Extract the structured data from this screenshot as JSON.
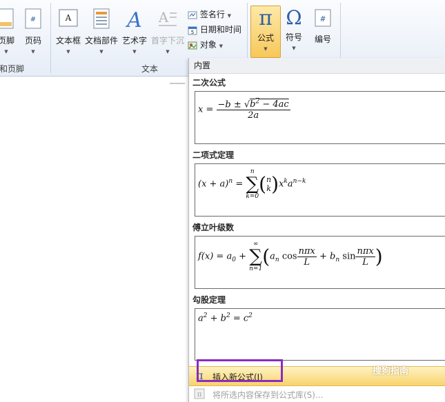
{
  "ribbon": {
    "groups": [
      {
        "label": "和页脚"
      },
      {
        "label": "文本"
      }
    ],
    "buttons": {
      "footer": "页脚",
      "page_number": "页码",
      "text_box": "文本框",
      "quick_parts": "文档部件",
      "wordart": "艺术字",
      "drop_cap": "首字下沉",
      "signature_line": "签名行",
      "date_time": "日期和时间",
      "object": "对象",
      "equation": "公式",
      "symbol": "符号",
      "number": "编号"
    }
  },
  "dropdown": {
    "header": "内置",
    "items": [
      {
        "title": "二次公式"
      },
      {
        "title": "二项式定理"
      },
      {
        "title": "傅立叶级数"
      },
      {
        "title": "勾股定理"
      }
    ],
    "insert_new": "插入新公式(I)",
    "save_selection": "将所选内容保存到公式库(S)..."
  },
  "watermark": "搜狗指南",
  "colors": {
    "highlight": "#8b2bc0",
    "ribbon_active": "#f7d36c"
  }
}
